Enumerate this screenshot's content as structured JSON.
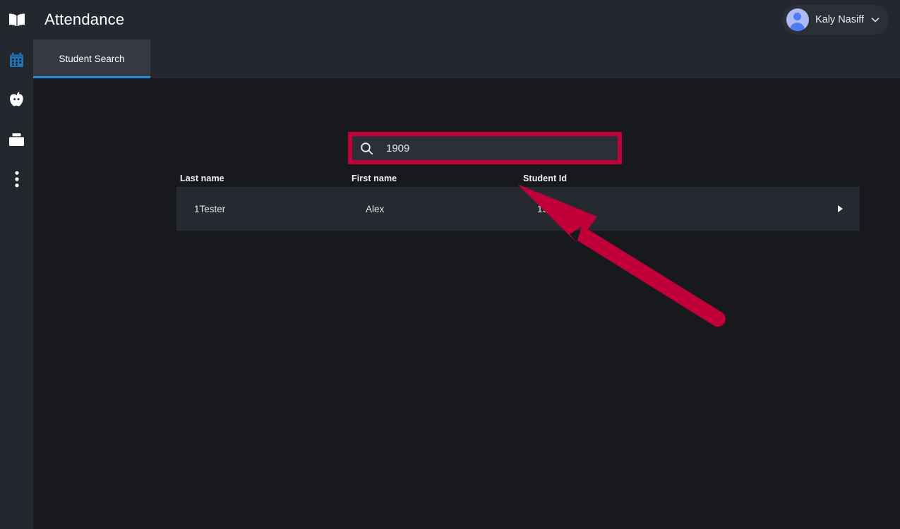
{
  "app": {
    "title": "Attendance",
    "accent_blue": "#1f8fd6",
    "annotation_red": "#c1003a",
    "rail_bg": "#24272e",
    "topbar_bg": "#24272f",
    "content_bg": "#17191c",
    "row_bg": "#262930"
  },
  "sidebar": {
    "items": [
      {
        "icon": "book-icon",
        "label": "Gradebook",
        "active": false
      },
      {
        "icon": "calendar-icon",
        "label": "Attendance",
        "active": true
      },
      {
        "icon": "apple-icon",
        "label": "Teacher",
        "active": false
      },
      {
        "icon": "briefcase-icon",
        "label": "Resources",
        "active": false
      },
      {
        "icon": "more-vertical-icon",
        "label": "More",
        "active": false
      }
    ]
  },
  "header": {
    "title": "Attendance",
    "user": {
      "name": "Kaly Nasiff",
      "avatar_icon": "user-avatar-icon",
      "chevron_icon": "chevron-down-icon"
    }
  },
  "tabs": [
    {
      "label": "Student Search",
      "active": true
    }
  ],
  "search": {
    "icon": "search-icon",
    "value": "1909",
    "placeholder": "",
    "highlighted": true
  },
  "table": {
    "columns": [
      "Last name",
      "First name",
      "Student Id"
    ],
    "rows": [
      {
        "last_name": "1Tester",
        "first_name": "Alex",
        "student_id": "1909",
        "expand_icon": "triangle-right-icon"
      }
    ]
  },
  "annotation": {
    "type": "arrow",
    "color": "#c1003a",
    "points_to": "student-result-row"
  }
}
